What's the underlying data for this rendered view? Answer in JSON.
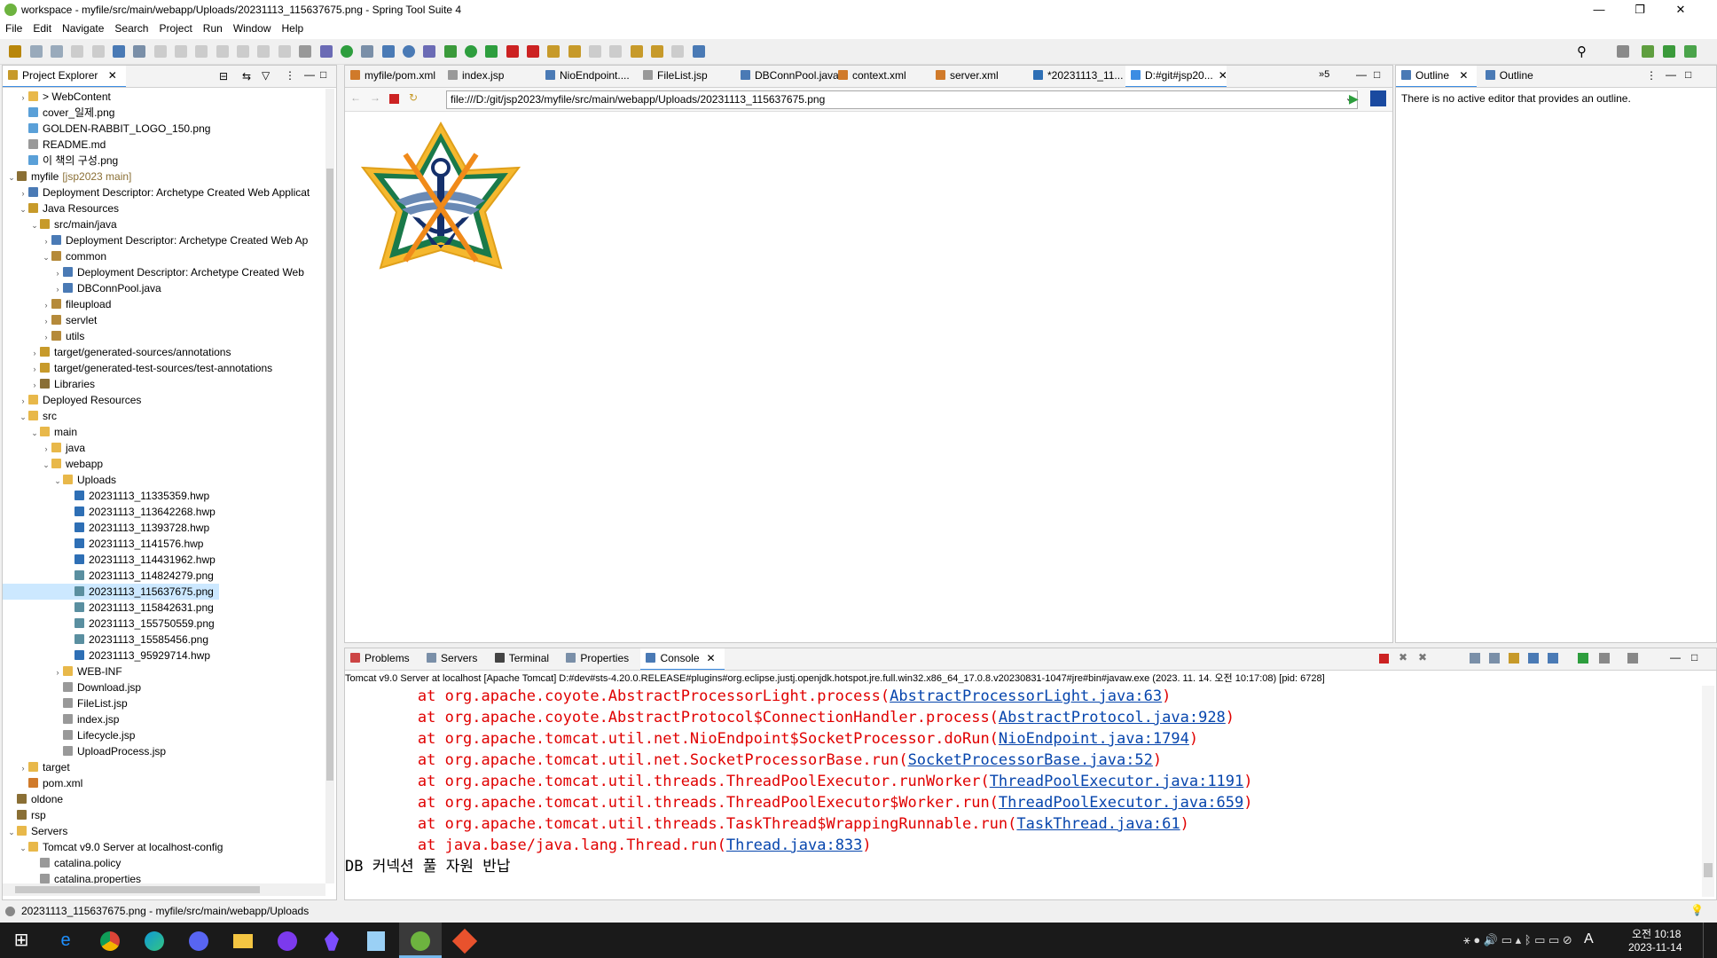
{
  "title": "workspace - myfile/src/main/webapp/Uploads/20231113_115637675.png - Spring Tool Suite 4",
  "window_controls": [
    "—",
    "❐",
    "✕"
  ],
  "menu": [
    "File",
    "Edit",
    "Navigate",
    "Search",
    "Project",
    "Run",
    "Window",
    "Help"
  ],
  "explorer": {
    "tab_label": "Project Explorer",
    "items": [
      {
        "indent": 1,
        "arrow": "›",
        "label": "> WebContent",
        "icon": "folder-icon"
      },
      {
        "indent": 1,
        "arrow": "",
        "label": "cover_일제.png",
        "icon": "image-icon"
      },
      {
        "indent": 1,
        "arrow": "",
        "label": "GOLDEN-RABBIT_LOGO_150.png",
        "icon": "image-icon"
      },
      {
        "indent": 1,
        "arrow": "",
        "label": "README.md",
        "icon": "file-icon"
      },
      {
        "indent": 1,
        "arrow": "",
        "label": "이 책의 구성.png",
        "icon": "image-icon"
      },
      {
        "indent": 0,
        "arrow": "⌄",
        "label": "myfile",
        "decor": "[jsp2023 main]",
        "icon": "project-icon"
      },
      {
        "indent": 1,
        "arrow": "›",
        "label": "Deployment Descriptor: Archetype Created Web Applicat",
        "icon": "descriptor-icon"
      },
      {
        "indent": 1,
        "arrow": "⌄",
        "label": "Java Resources",
        "icon": "java-resources-icon"
      },
      {
        "indent": 2,
        "arrow": "⌄",
        "label": "src/main/java",
        "icon": "source-folder-icon"
      },
      {
        "indent": 3,
        "arrow": "›",
        "label": "Deployment Descriptor: Archetype Created Web Ap",
        "icon": "descriptor-icon"
      },
      {
        "indent": 3,
        "arrow": "⌄",
        "label": "common",
        "icon": "package-icon"
      },
      {
        "indent": 4,
        "arrow": "›",
        "label": "Deployment Descriptor: Archetype Created Web",
        "icon": "descriptor-icon"
      },
      {
        "indent": 4,
        "arrow": "›",
        "label": "DBConnPool.java",
        "icon": "java-file-icon"
      },
      {
        "indent": 3,
        "arrow": "›",
        "label": "fileupload",
        "icon": "package-icon"
      },
      {
        "indent": 3,
        "arrow": "›",
        "label": "servlet",
        "icon": "package-icon"
      },
      {
        "indent": 3,
        "arrow": "›",
        "label": "utils",
        "icon": "package-icon"
      },
      {
        "indent": 2,
        "arrow": "›",
        "label": "target/generated-sources/annotations",
        "icon": "source-folder-icon"
      },
      {
        "indent": 2,
        "arrow": "›",
        "label": "target/generated-test-sources/test-annotations",
        "icon": "source-folder-icon"
      },
      {
        "indent": 2,
        "arrow": "›",
        "label": "Libraries",
        "icon": "library-icon"
      },
      {
        "indent": 1,
        "arrow": "›",
        "label": "Deployed Resources",
        "icon": "folder-icon"
      },
      {
        "indent": 1,
        "arrow": "⌄",
        "label": "src",
        "icon": "folder-icon"
      },
      {
        "indent": 2,
        "arrow": "⌄",
        "label": "main",
        "icon": "folder-icon"
      },
      {
        "indent": 3,
        "arrow": "›",
        "label": "java",
        "icon": "folder-icon"
      },
      {
        "indent": 3,
        "arrow": "⌄",
        "label": "webapp",
        "icon": "folder-icon"
      },
      {
        "indent": 4,
        "arrow": "⌄",
        "label": "Uploads",
        "icon": "folder-icon"
      },
      {
        "indent": 5,
        "arrow": "",
        "label": "20231113_11335359.hwp",
        "icon": "hwp-file-icon"
      },
      {
        "indent": 5,
        "arrow": "",
        "label": "20231113_113642268.hwp",
        "icon": "hwp-file-icon"
      },
      {
        "indent": 5,
        "arrow": "",
        "label": "20231113_11393728.hwp",
        "icon": "hwp-file-icon"
      },
      {
        "indent": 5,
        "arrow": "",
        "label": "20231113_1141576.hwp",
        "icon": "hwp-file-icon"
      },
      {
        "indent": 5,
        "arrow": "",
        "label": "20231113_114431962.hwp",
        "icon": "hwp-file-icon"
      },
      {
        "indent": 5,
        "arrow": "",
        "label": "20231113_114824279.png",
        "icon": "png-file-icon"
      },
      {
        "indent": 5,
        "arrow": "",
        "label": "20231113_115637675.png",
        "icon": "png-file-icon",
        "selected": true
      },
      {
        "indent": 5,
        "arrow": "",
        "label": "20231113_115842631.png",
        "icon": "png-file-icon"
      },
      {
        "indent": 5,
        "arrow": "",
        "label": "20231113_155750559.png",
        "icon": "png-file-icon"
      },
      {
        "indent": 5,
        "arrow": "",
        "label": "20231113_15585456.png",
        "icon": "png-file-icon"
      },
      {
        "indent": 5,
        "arrow": "",
        "label": "20231113_95929714.hwp",
        "icon": "hwp-file-icon"
      },
      {
        "indent": 4,
        "arrow": "›",
        "label": "WEB-INF",
        "icon": "folder-icon"
      },
      {
        "indent": 4,
        "arrow": "",
        "label": "Download.jsp",
        "icon": "jsp-file-icon"
      },
      {
        "indent": 4,
        "arrow": "",
        "label": "FileList.jsp",
        "icon": "jsp-file-icon"
      },
      {
        "indent": 4,
        "arrow": "",
        "label": "index.jsp",
        "icon": "jsp-file-icon"
      },
      {
        "indent": 4,
        "arrow": "",
        "label": "Lifecycle.jsp",
        "icon": "jsp-file-icon"
      },
      {
        "indent": 4,
        "arrow": "",
        "label": "UploadProcess.jsp",
        "icon": "jsp-file-icon"
      },
      {
        "indent": 1,
        "arrow": "›",
        "label": "target",
        "icon": "folder-icon"
      },
      {
        "indent": 1,
        "arrow": "",
        "label": "pom.xml",
        "icon": "xml-file-icon"
      },
      {
        "indent": 0,
        "arrow": "",
        "label": "oldone",
        "icon": "project-icon"
      },
      {
        "indent": 0,
        "arrow": "",
        "label": "rsp",
        "icon": "project-icon"
      },
      {
        "indent": 0,
        "arrow": "⌄",
        "label": "Servers",
        "icon": "folder-icon"
      },
      {
        "indent": 1,
        "arrow": "⌄",
        "label": "Tomcat v9.0 Server at localhost-config",
        "icon": "folder-icon"
      },
      {
        "indent": 2,
        "arrow": "",
        "label": "catalina.policy",
        "icon": "file-icon"
      },
      {
        "indent": 2,
        "arrow": "",
        "label": "catalina.properties",
        "icon": "file-icon"
      }
    ]
  },
  "editor": {
    "tabs": [
      {
        "label": "myfile/pom.xml",
        "icon": "xml-file-icon"
      },
      {
        "label": "index.jsp",
        "icon": "jsp-file-icon"
      },
      {
        "label": "NioEndpoint....",
        "icon": "class-file-icon"
      },
      {
        "label": "FileList.jsp",
        "icon": "jsp-file-icon"
      },
      {
        "label": "DBConnPool.java",
        "icon": "java-file-icon"
      },
      {
        "label": "context.xml",
        "icon": "xml-file-icon"
      },
      {
        "label": "server.xml",
        "icon": "xml-file-icon"
      },
      {
        "label": "*20231113_11...",
        "icon": "hwp-file-icon"
      },
      {
        "label": "D:#git#jsp20...",
        "icon": "browser-icon",
        "active": true
      }
    ],
    "overflow": "»5",
    "url": "file:///D:/git/jsp2023/myfile/src/main/webapp/Uploads/20231113_115637675.png"
  },
  "outline": {
    "tabs": [
      "Outline",
      "Outline"
    ],
    "message": "There is no active editor that provides an outline."
  },
  "console": {
    "tabs": [
      "Problems",
      "Servers",
      "Terminal",
      "Properties",
      "Console"
    ],
    "header": "Tomcat v9.0 Server at localhost [Apache Tomcat] D:#dev#sts-4.20.0.RELEASE#plugins#org.eclipse.justj.openjdk.hotspot.jre.full.win32.x86_64_17.0.8.v20230831-1047#jre#bin#javaw.exe  (2023. 11. 14. 오전 10:17:08) [pid: 6728]",
    "lines": [
      {
        "pre": "        at org.apache.coyote.AbstractProcessorLight.process(",
        "link": "AbstractProcessorLight.java:63",
        "post": ")"
      },
      {
        "pre": "        at org.apache.coyote.AbstractProtocol$ConnectionHandler.process(",
        "link": "AbstractProtocol.java:928",
        "post": ")"
      },
      {
        "pre": "        at org.apache.tomcat.util.net.NioEndpoint$SocketProcessor.doRun(",
        "link": "NioEndpoint.java:1794",
        "post": ")"
      },
      {
        "pre": "        at org.apache.tomcat.util.net.SocketProcessorBase.run(",
        "link": "SocketProcessorBase.java:52",
        "post": ")"
      },
      {
        "pre": "        at org.apache.tomcat.util.threads.ThreadPoolExecutor.runWorker(",
        "link": "ThreadPoolExecutor.java:1191",
        "post": ")"
      },
      {
        "pre": "        at org.apache.tomcat.util.threads.ThreadPoolExecutor$Worker.run(",
        "link": "ThreadPoolExecutor.java:659",
        "post": ")"
      },
      {
        "pre": "        at org.apache.tomcat.util.threads.TaskThread$WrappingRunnable.run(",
        "link": "TaskThread.java:61",
        "post": ")"
      },
      {
        "pre": "        at java.base/java.lang.Thread.run(",
        "link": "Thread.java:833",
        "post": ")"
      }
    ],
    "last_line": "DB 커넥션 풀 자원 반납"
  },
  "statusbar": "20231113_115637675.png - myfile/src/main/webapp/Uploads",
  "taskbar": {
    "apps": [
      "start-icon",
      "ie-icon",
      "chrome-icon",
      "edge-icon",
      "discord-icon",
      "explorer-icon",
      "github-icon",
      "obsidian-icon",
      "notepad-icon",
      "sts-icon",
      "git-icon"
    ],
    "time": "오전 10:18",
    "date": "2023-11-14",
    "ime": "A"
  },
  "colors": {
    "accent": "#3c8de3",
    "error": "#e00000",
    "link": "#0645ad",
    "selection": "#cce8ff",
    "taskbar": "#1a1a1a",
    "emblem_green": "#1a7a4a",
    "emblem_gold": "#e3b21a",
    "emblem_navy": "#15306b"
  }
}
